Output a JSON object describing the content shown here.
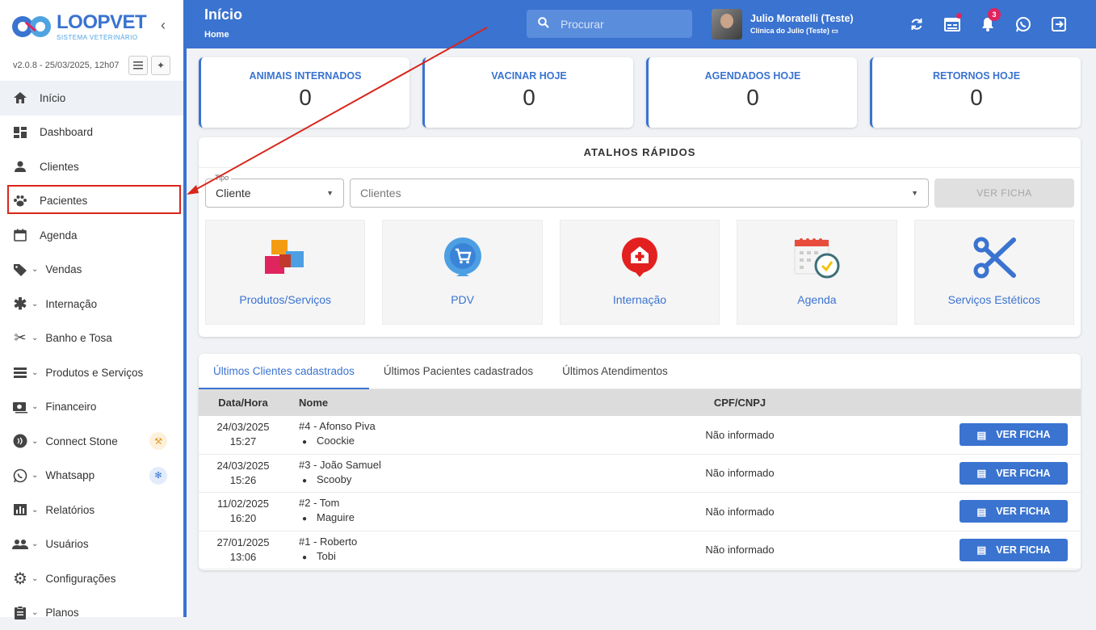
{
  "sidebar": {
    "logo": {
      "title_part1": "LOOP",
      "title_part2": "VET",
      "subtitle": "SISTEMA VETERINÁRIO"
    },
    "collapse_icon": "chevron-left-icon",
    "version": "v2.0.8 - 25/03/2025, 12h07",
    "items": [
      {
        "label": "Início",
        "icon": "home-icon",
        "expandable": false,
        "active": true
      },
      {
        "label": "Dashboard",
        "icon": "dashboard-icon",
        "expandable": false
      },
      {
        "label": "Clientes",
        "icon": "person-icon",
        "expandable": false
      },
      {
        "label": "Pacientes",
        "icon": "paw-icon",
        "expandable": false,
        "highlighted": true
      },
      {
        "label": "Agenda",
        "icon": "calendar-icon",
        "expandable": false
      },
      {
        "label": "Vendas",
        "icon": "tag-icon",
        "expandable": true
      },
      {
        "label": "Internação",
        "icon": "asterisk-icon",
        "expandable": true
      },
      {
        "label": "Banho e Tosa",
        "icon": "scissors-icon",
        "expandable": true
      },
      {
        "label": "Produtos e Serviços",
        "icon": "list-icon",
        "expandable": true
      },
      {
        "label": "Financeiro",
        "icon": "money-icon",
        "expandable": true
      },
      {
        "label": "Connect Stone",
        "icon": "stone-icon",
        "expandable": true,
        "badge": "tools-icon"
      },
      {
        "label": "Whatsapp",
        "icon": "whatsapp-icon",
        "expandable": true,
        "badge": "party-icon"
      },
      {
        "label": "Relatórios",
        "icon": "chart-icon",
        "expandable": true
      },
      {
        "label": "Usuários",
        "icon": "users-icon",
        "expandable": true
      },
      {
        "label": "Configurações",
        "icon": "gear-icon",
        "expandable": true
      },
      {
        "label": "Planos",
        "icon": "clipboard-icon",
        "expandable": true
      }
    ]
  },
  "header": {
    "title": "Início",
    "breadcrumb": "Home",
    "search_placeholder": "Procurar",
    "user_name": "Julio Moratelli (Teste)",
    "clinic": "Clínica do Julio (Teste)",
    "notification_count": "3"
  },
  "stats": [
    {
      "label": "ANIMAIS INTERNADOS",
      "value": "0"
    },
    {
      "label": "VACINAR HOJE",
      "value": "0"
    },
    {
      "label": "AGENDADOS HOJE",
      "value": "0"
    },
    {
      "label": "RETORNOS HOJE",
      "value": "0"
    }
  ],
  "shortcuts": {
    "title": "ATALHOS RÁPIDOS",
    "type_label": "Tipo",
    "type_value": "Cliente",
    "client_placeholder": "Clientes",
    "view_button": "VER FICHA",
    "tiles": [
      {
        "label": "Produtos/Serviços",
        "icon": "boxes-icon"
      },
      {
        "label": "PDV",
        "icon": "cart-icon"
      },
      {
        "label": "Internação",
        "icon": "hospital-icon"
      },
      {
        "label": "Agenda",
        "icon": "calendar-clock-icon"
      },
      {
        "label": "Serviços Estéticos",
        "icon": "scissors-icon"
      }
    ]
  },
  "recent": {
    "tabs": [
      "Últimos Clientes cadastrados",
      "Últimos Pacientes cadastrados",
      "Últimos Atendimentos"
    ],
    "columns": [
      "Data/Hora",
      "Nome",
      "CPF/CNPJ"
    ],
    "rows": [
      {
        "date": "24/03/2025",
        "time": "15:27",
        "client": "#4 - Afonso Piva",
        "pet": "Coockie",
        "doc": "Não informado"
      },
      {
        "date": "24/03/2025",
        "time": "15:26",
        "client": "#3 - João Samuel",
        "pet": "Scooby",
        "doc": "Não informado"
      },
      {
        "date": "11/02/2025",
        "time": "16:20",
        "client": "#2 - Tom",
        "pet": "Maguire",
        "doc": "Não informado"
      },
      {
        "date": "27/01/2025",
        "time": "13:06",
        "client": "#1 - Roberto",
        "pet": "Tobi",
        "doc": "Não informado"
      }
    ],
    "row_button": "VER FICHA"
  },
  "colors": {
    "primary": "#3a73d0",
    "annotation": "#d9261c",
    "badge": "#e0245e"
  }
}
